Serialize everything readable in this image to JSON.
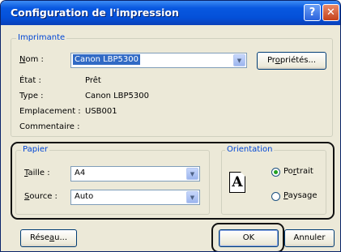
{
  "window": {
    "title": "Configuration de l'impression",
    "help": "?",
    "close": "✕"
  },
  "printer": {
    "legend": "Imprimante",
    "name_label": "Nom :",
    "name_value": "Canon LBP5300",
    "properties_button": "Propriétés...",
    "status_label": "État :",
    "status_value": "Prêt",
    "type_label": "Type :",
    "type_value": "Canon LBP5300",
    "location_label": "Emplacement :",
    "location_value": "USB001",
    "comment_label": "Commentaire :"
  },
  "paper": {
    "legend": "Papier",
    "size_label": "Taille :",
    "size_value": "A4",
    "source_label": "Source :",
    "source_value": "Auto"
  },
  "orientation": {
    "legend": "Orientation",
    "icon_letter": "A",
    "portrait_label": "Portrait",
    "landscape_label": "Paysage",
    "selected": "Portrait"
  },
  "footer": {
    "network_button": "Réseau...",
    "ok_button": "OK",
    "cancel_button": "Annuler"
  },
  "icons": {
    "dropdown": "chevron-down-icon",
    "orientation": "portrait-page-icon"
  }
}
